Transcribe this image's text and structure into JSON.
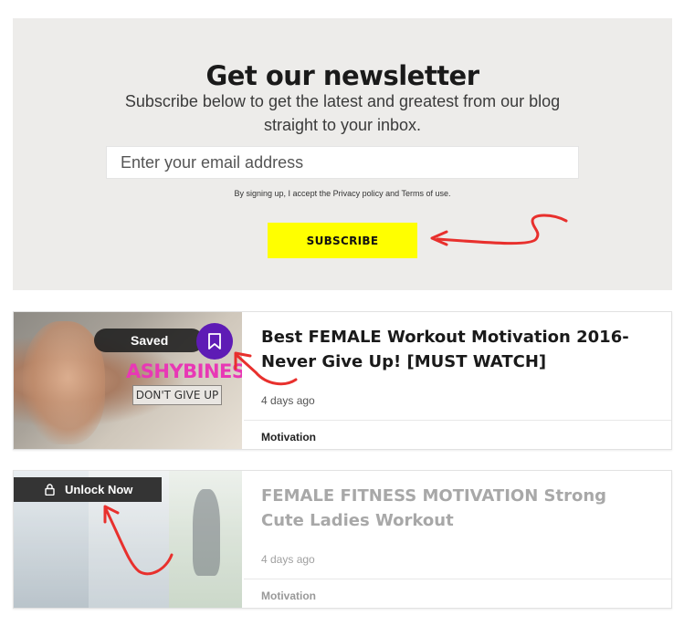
{
  "newsletter": {
    "title": "Get our newsletter",
    "subtitle_line1": "Subscribe below to get the latest and greatest from our blog",
    "subtitle_line2": "straight to your inbox.",
    "email_placeholder": "Enter your email address",
    "terms": "By signing up, I accept the Privacy policy and Terms of use.",
    "subscribe_label": "SUBSCRIBE",
    "button_color": "#ffff00"
  },
  "cards": [
    {
      "title": "Best FEMALE Workout Motivation 2016- Never Give Up! [MUST WATCH]",
      "date": "4 days ago",
      "category": "Motivation",
      "thumb_brand": "ASHYBINES",
      "thumb_tag": "DON'T GIVE UP",
      "saved_label": "Saved",
      "bookmark_icon": "bookmark-icon",
      "bookmark_color": "#5e1bb5",
      "brand_color": "#e838b5"
    },
    {
      "title": "FEMALE FITNESS MOTIVATION Strong Cute Ladies Workout",
      "date": "4 days ago",
      "category": "Motivation",
      "unlock_label": "Unlock Now",
      "unlock_icon": "lock-icon"
    }
  ],
  "annotation_color": "#e8302d"
}
